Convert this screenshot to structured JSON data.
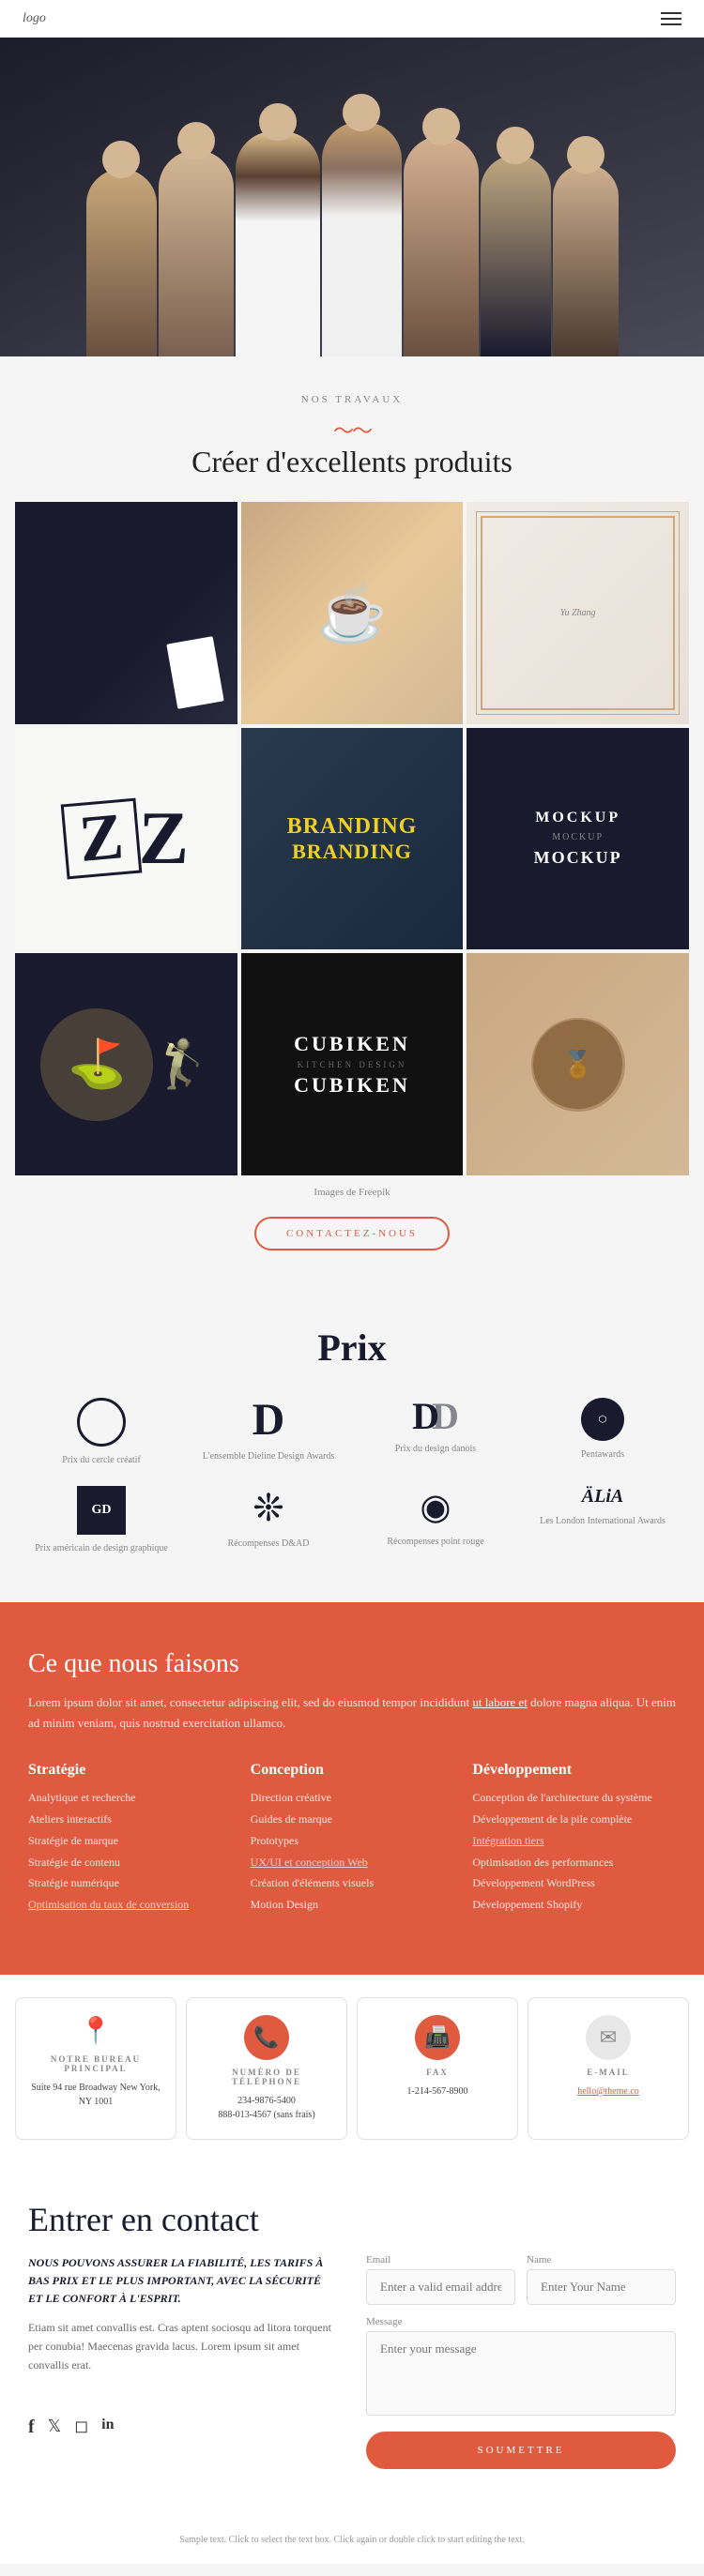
{
  "header": {
    "logo": "logo"
  },
  "hero": {
    "alt": "Team photo with thumbs up"
  },
  "nos_travaux": {
    "section_label": "NOS TRAVAUX",
    "section_title": "Créer d'excellents produits",
    "caption": "Images de Freepik",
    "contactez_label": "CONTACTEZ-NOUS"
  },
  "prix": {
    "title": "Prix",
    "awards": [
      {
        "icon": "◯",
        "label": "Prix du cercle créatif"
      },
      {
        "icon": "𝔻",
        "label": "L'ensemble Dieline Design Awards"
      },
      {
        "icon": "𝔻",
        "label": "Prix du design danois"
      },
      {
        "icon": "⬡",
        "label": "Pentawards"
      },
      {
        "icon": "GD",
        "label": "Prix américain de design graphique"
      },
      {
        "icon": "❊",
        "label": "Récompenses D&AD"
      },
      {
        "icon": "◉",
        "label": "Récompenses point rouge"
      },
      {
        "icon": "ALIA",
        "label": "Les London International Awards"
      }
    ]
  },
  "services": {
    "title": "Ce que nous faisons",
    "intro": "Lorem ipsum dolor sit amet, consectetur adipiscing elit, sed do eiusmod tempor incididunt ut labore et dolore magna aliqua. Ut enim ad minim veniam, quis nostrud exercitation ullamco.",
    "intro_link_text": "ut labore et",
    "columns": [
      {
        "title": "Stratégie",
        "items": [
          "Analytique et recherche",
          "Ateliers interactifs",
          "Stratégie de marque",
          "Stratégie de contenu",
          "Stratégie numérique",
          "Optimisation du taux de conversion"
        ]
      },
      {
        "title": "Conception",
        "items": [
          "Direction créative",
          "Guides de marque",
          "Prototypes",
          "UX/UI et conception Web",
          "Création d'éléments visuels",
          "Motion Design"
        ]
      },
      {
        "title": "Développement",
        "items": [
          "Conception de l'architecture du système",
          "Développement de la pile complète",
          "Intégration tiers",
          "Optimisation des performances",
          "Développement WordPress",
          "Développement Shopify"
        ]
      }
    ]
  },
  "contact_cards": [
    {
      "icon": "📍",
      "title": "NOTRE BUREAU PRINCIPAL",
      "value": "Suite 94 rue Broadway New York, NY 1001"
    },
    {
      "icon": "📞",
      "title": "NUMÉRO DE TÉLÉPHONE",
      "value": "234-9876-5400\n888-013-4567 (sans frais)"
    },
    {
      "icon": "📠",
      "title": "FAX",
      "value": "1-214-567-8900"
    },
    {
      "icon": "✉",
      "title": "E-MAIL",
      "value": "hello@theme.co"
    }
  ],
  "entrer": {
    "title": "Entrer en contact",
    "subtitle": "NOUS POUVONS ASSURER LA FIABILITÉ, LES TARIFS À BAS PRIX ET LE PLUS IMPORTANT, AVEC LA SÉCURITÉ ET LE CONFORT À L'ESPRIT.",
    "body": "Etiam sit amet convallis est. Cras aptent sociosqu ad litora torquent per conubia! Maecenas gravida lacus. Lorem ipsum sit amet convallis erat.",
    "form": {
      "email_placeholder": "Enter a valid email address",
      "email_label": "Email",
      "name_placeholder": "Enter Your Name",
      "name_label": "Name",
      "message_placeholder": "Enter your message",
      "message_label": "Message",
      "submit_label": "SOUMETTRE"
    }
  },
  "footer": {
    "sample_text": "Sample text. Click to select the text box. Click again or double click to start editing the text."
  }
}
